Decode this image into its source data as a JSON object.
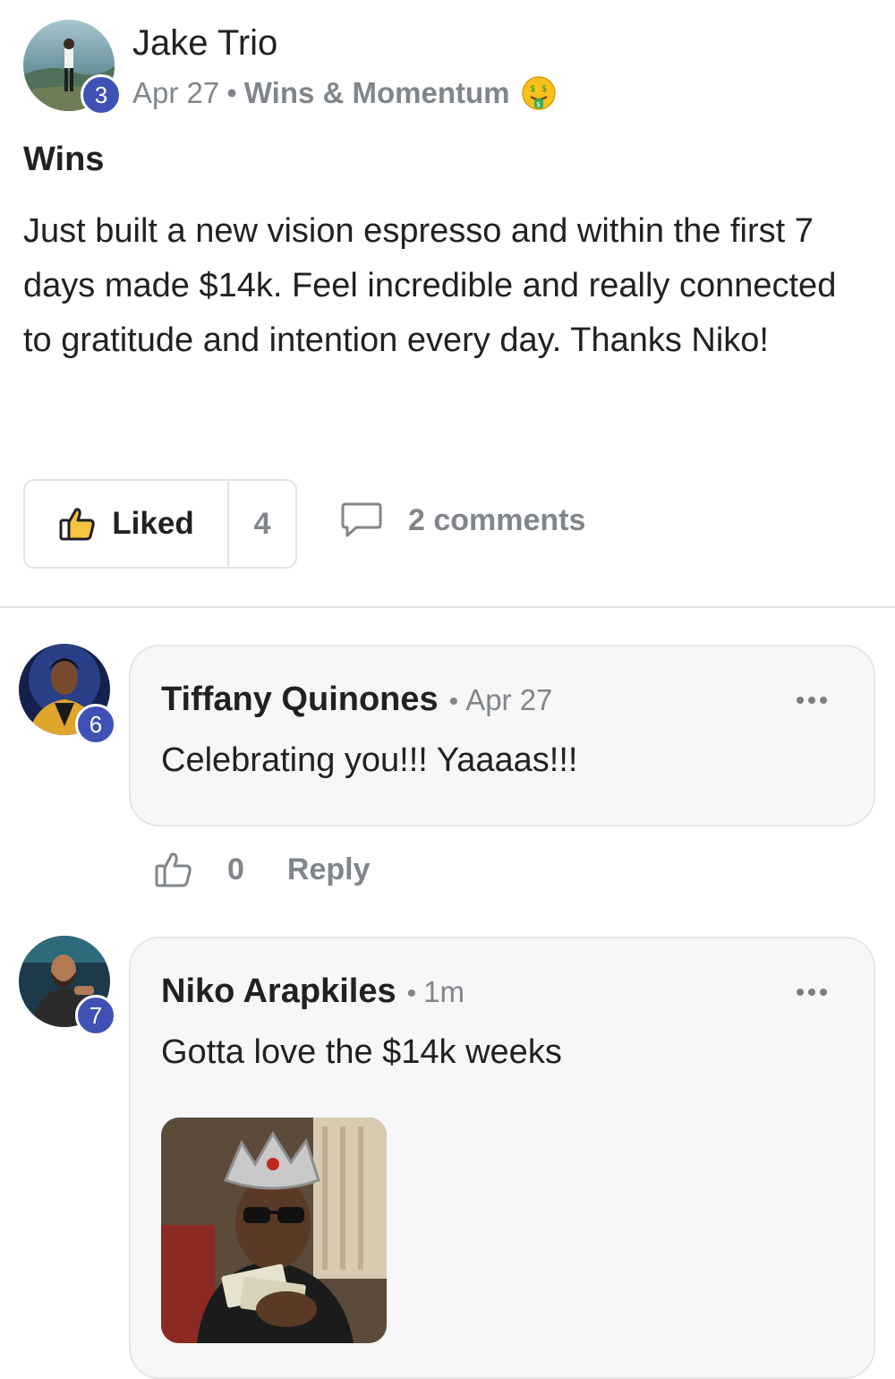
{
  "post": {
    "author": "Jake Trio",
    "author_level": "3",
    "date": "Apr 27",
    "separator": "•",
    "category": "Wins & Momentum",
    "category_emoji": "money-mouth-face-icon",
    "title": "Wins",
    "body": "Just built a new vision espresso and within the first 7 days made $14k. Feel incredible and really connected to gratitude and intention every day. Thanks Niko!",
    "like_label": "Liked",
    "like_count": "4",
    "comments_label": "2 comments"
  },
  "comments": [
    {
      "author": "Tiffany Quinones",
      "level": "6",
      "separator": "•",
      "time": "Apr 27",
      "text": "Celebrating you!!! Yaaaas!!!",
      "like_count": "0",
      "reply_label": "Reply"
    },
    {
      "author": "Niko Arapkiles",
      "level": "7",
      "separator": "•",
      "time": "1m",
      "text": "Gotta love the $14k weeks",
      "has_gif": true
    }
  ],
  "colors": {
    "badge": "#3f51b5",
    "muted_text": "#80868b",
    "bubble_bg": "#f7f7f7"
  }
}
